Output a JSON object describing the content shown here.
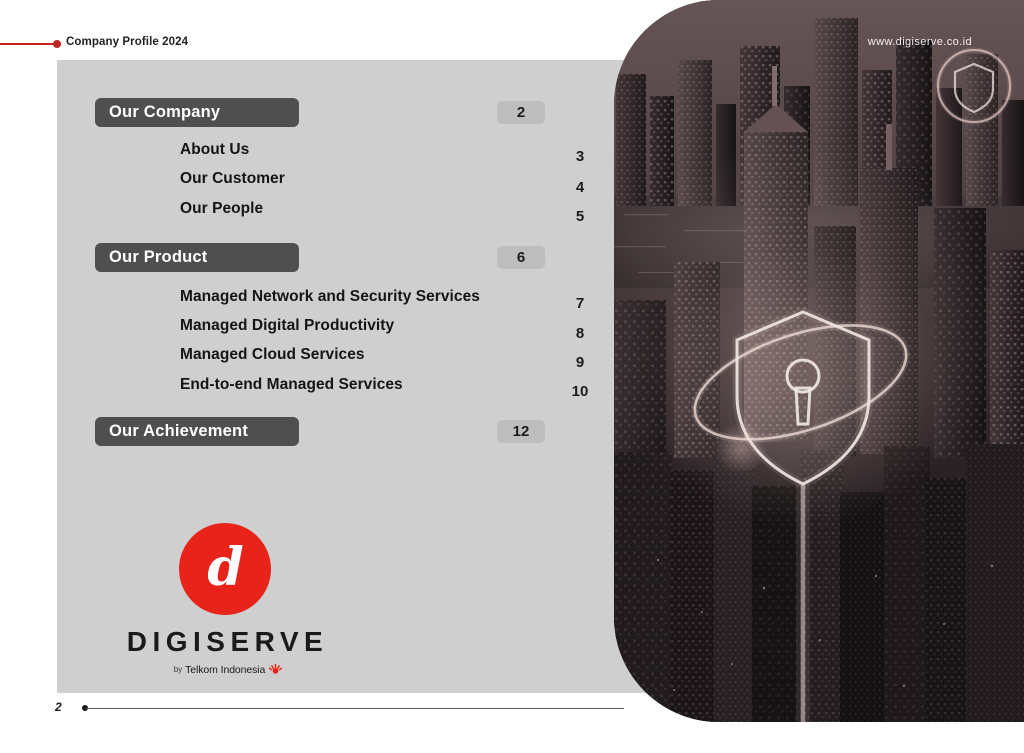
{
  "document": {
    "header_label": "Company Profile 2024",
    "page_number": "2",
    "website": "www.digiserve.co.id"
  },
  "colors": {
    "accent_red": "#c0251f",
    "logo_red": "#e8231a",
    "panel_grey": "#cfcfcf",
    "section_pill": "#4f4f4f",
    "page_badge": "#bdbdbd"
  },
  "toc": {
    "sections": [
      {
        "label": "Our Company",
        "page": "2",
        "items": [
          {
            "label": "About Us",
            "page": "3"
          },
          {
            "label": "Our Customer",
            "page": "4"
          },
          {
            "label": "Our People",
            "page": "5"
          }
        ]
      },
      {
        "label": "Our Product",
        "page": "6",
        "items": [
          {
            "label": "Managed Network and Security Services",
            "page": "7"
          },
          {
            "label": "Managed Digital Productivity",
            "page": "8"
          },
          {
            "label": "Managed Cloud Services",
            "page": "9"
          },
          {
            "label": "End-to-end Managed Services",
            "page": "10"
          }
        ]
      },
      {
        "label": "Our Achievement",
        "page": "12",
        "items": []
      }
    ]
  },
  "logo": {
    "monogram": "d",
    "wordmark": "DIGISERVE",
    "tagline_by": "by",
    "tagline_name": "Telkom Indonesia"
  },
  "photo": {
    "description": "night aerial cityscape with glowing shield security graphics"
  }
}
